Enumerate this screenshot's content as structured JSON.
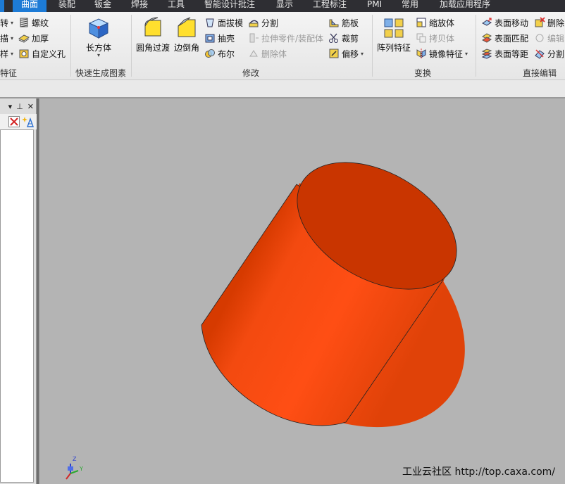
{
  "menu": {
    "tabs": [
      "曲面",
      "装配",
      "钣金",
      "焊接",
      "工具",
      "智能设计批注",
      "显示",
      "工程标注",
      "PMI",
      "常用",
      "加载应用程序"
    ],
    "active_tab": "曲面"
  },
  "ribbon": {
    "groups": {
      "feature": {
        "title": "特征",
        "items": [
          "转",
          "螺纹",
          "描",
          "加厚",
          "样",
          "自定义孔"
        ]
      },
      "quick": {
        "title": "快速生成图素",
        "box_label": "长方体"
      },
      "modify": {
        "title": "修改",
        "fillet_label": "圆角过渡",
        "chamfer_label": "边倒角",
        "draft_label": "面拔模",
        "shell_label": "抽壳",
        "boolean_label": "布尔",
        "split_label": "分割",
        "stretch_label": "拉伸零件/装配体",
        "delete_body_label": "删除体",
        "rib_label": "筋板",
        "trim_label": "裁剪",
        "offset_label": "偏移"
      },
      "transform": {
        "title": "变换",
        "pattern_label": "阵列特征",
        "scale_label": "缩放体",
        "copy_label": "拷贝体",
        "mirror_label": "镜像特征"
      },
      "direct_edit": {
        "title": "直接编辑",
        "move_face_label": "表面移动",
        "match_face_label": "表面匹配",
        "equidistant_face_label": "表面等距",
        "delete_label": "删除",
        "edit_label": "编辑",
        "split_label": "分割"
      }
    }
  },
  "panel": {
    "pin_glyph": "▾  ⊥  ✕"
  },
  "viewport": {
    "triad": {
      "z": "Z",
      "y": "Y"
    },
    "watermark": "工业云社区 http://top.caxa.com/",
    "model_color": "#f04a12"
  }
}
